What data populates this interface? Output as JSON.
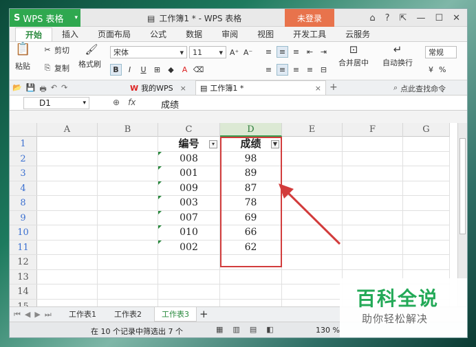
{
  "app": {
    "name": "WPS 表格",
    "window_title": "工作簿1 * - WPS 表格",
    "login": "未登录",
    "ctrl_icons": [
      "shirt-icon",
      "help-icon",
      "restore-icon",
      "minimize-icon",
      "maximize-icon",
      "close-icon"
    ]
  },
  "menu": [
    "开始",
    "插入",
    "页面布局",
    "公式",
    "数据",
    "审阅",
    "视图",
    "开发工具",
    "云服务"
  ],
  "ribbon": {
    "paste": "粘贴",
    "cut": "剪切",
    "copy": "复制",
    "format_painter": "格式刷",
    "font": "宋体",
    "size": "11",
    "merge": "合并居中",
    "wrap": "自动换行",
    "number_format": "常规",
    "percent": "%"
  },
  "quickbar": {
    "tab1": "我的WPS",
    "tab2": "工作簿1 *",
    "search": "点此查找命令"
  },
  "formula": {
    "cell": "D1",
    "fx": "fx",
    "value": "成绩"
  },
  "columns": [
    "A",
    "B",
    "C",
    "D",
    "E",
    "F",
    "G"
  ],
  "rows": [
    {
      "num": "1",
      "c": "编号",
      "d": "成绩",
      "header": true
    },
    {
      "num": "2",
      "c": "008",
      "d": "98"
    },
    {
      "num": "3",
      "c": "001",
      "d": "89"
    },
    {
      "num": "4",
      "c": "009",
      "d": "87"
    },
    {
      "num": "8",
      "c": "003",
      "d": "78"
    },
    {
      "num": "9",
      "c": "007",
      "d": "69"
    },
    {
      "num": "10",
      "c": "010",
      "d": "66"
    },
    {
      "num": "11",
      "c": "002",
      "d": "62"
    },
    {
      "num": "12",
      "c": "",
      "d": ""
    },
    {
      "num": "13",
      "c": "",
      "d": ""
    },
    {
      "num": "14",
      "c": "",
      "d": ""
    },
    {
      "num": "15",
      "c": "",
      "d": ""
    }
  ],
  "sheets": [
    "工作表1",
    "工作表2",
    "工作表3"
  ],
  "add_sheet": "+",
  "status": {
    "text": "在 10 个记录中筛选出 7 个",
    "zoom": "130 %"
  },
  "watermark": {
    "line1": "百科全说",
    "line2": "助你轻松解决"
  },
  "colors": {
    "accent": "#2fa84f",
    "login": "#e8734c",
    "highlight": "#d23c3c"
  }
}
